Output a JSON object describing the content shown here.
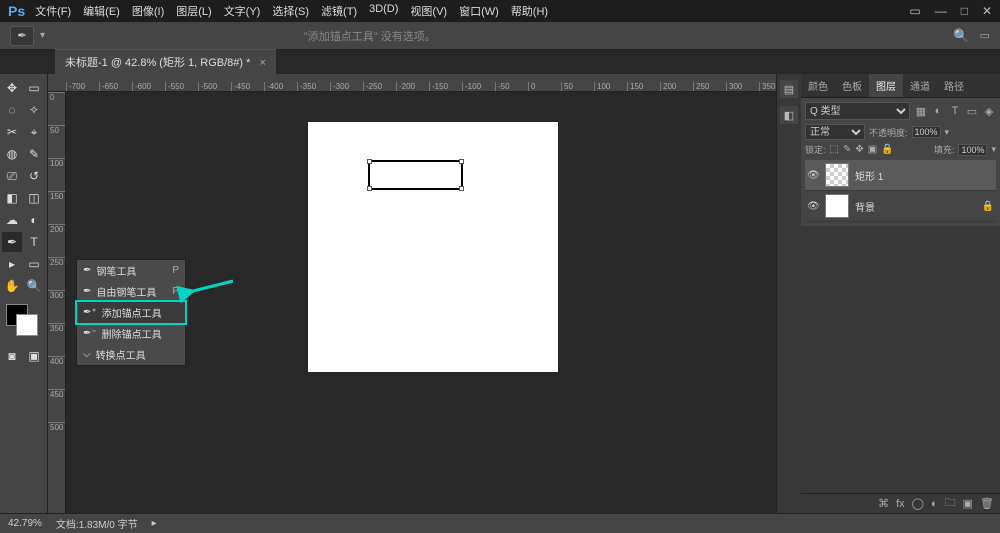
{
  "app": {
    "logo": "Ps"
  },
  "menu": [
    "文件(F)",
    "编辑(E)",
    "图像(I)",
    "图层(L)",
    "文字(Y)",
    "选择(S)",
    "滤镜(T)",
    "3D(D)",
    "视图(V)",
    "窗口(W)",
    "帮助(H)"
  ],
  "options": {
    "message": "\"添加锚点工具\" 没有选项。"
  },
  "document": {
    "tab_title": "未标题-1 @ 42.8% (矩形 1, RGB/8#) *"
  },
  "ruler_h_start": -700,
  "ruler_h_step": 50,
  "ruler_v": [
    "0",
    "50",
    "100",
    "150",
    "200",
    "250",
    "300",
    "350",
    "400",
    "450",
    "500"
  ],
  "flyout": {
    "items": [
      {
        "label": "钢笔工具",
        "shortcut": "P"
      },
      {
        "label": "自由钢笔工具",
        "shortcut": "P"
      },
      {
        "label": "添加锚点工具",
        "shortcut": ""
      },
      {
        "label": "删除锚点工具",
        "shortcut": ""
      },
      {
        "label": "转换点工具",
        "shortcut": ""
      }
    ],
    "highlight_index": 2
  },
  "panels": {
    "color_tabs": [
      "颜色",
      "色板",
      "图层",
      "通道",
      "路径"
    ],
    "active_tab": "图层",
    "filter_label": "类型",
    "filter_value": "Q 类型",
    "blend_mode": "正常",
    "opacity_label": "不透明度:",
    "opacity_value": "100%",
    "lock_label": "锁定:",
    "fill_label": "填充:",
    "fill_value": "100%",
    "layers": [
      {
        "name": "矩形 1",
        "selected": true,
        "pattern": true
      },
      {
        "name": "背景",
        "selected": false,
        "locked": true
      }
    ]
  },
  "status": {
    "zoom": "42.79%",
    "docinfo": "文档:1.83M/0 字节"
  }
}
